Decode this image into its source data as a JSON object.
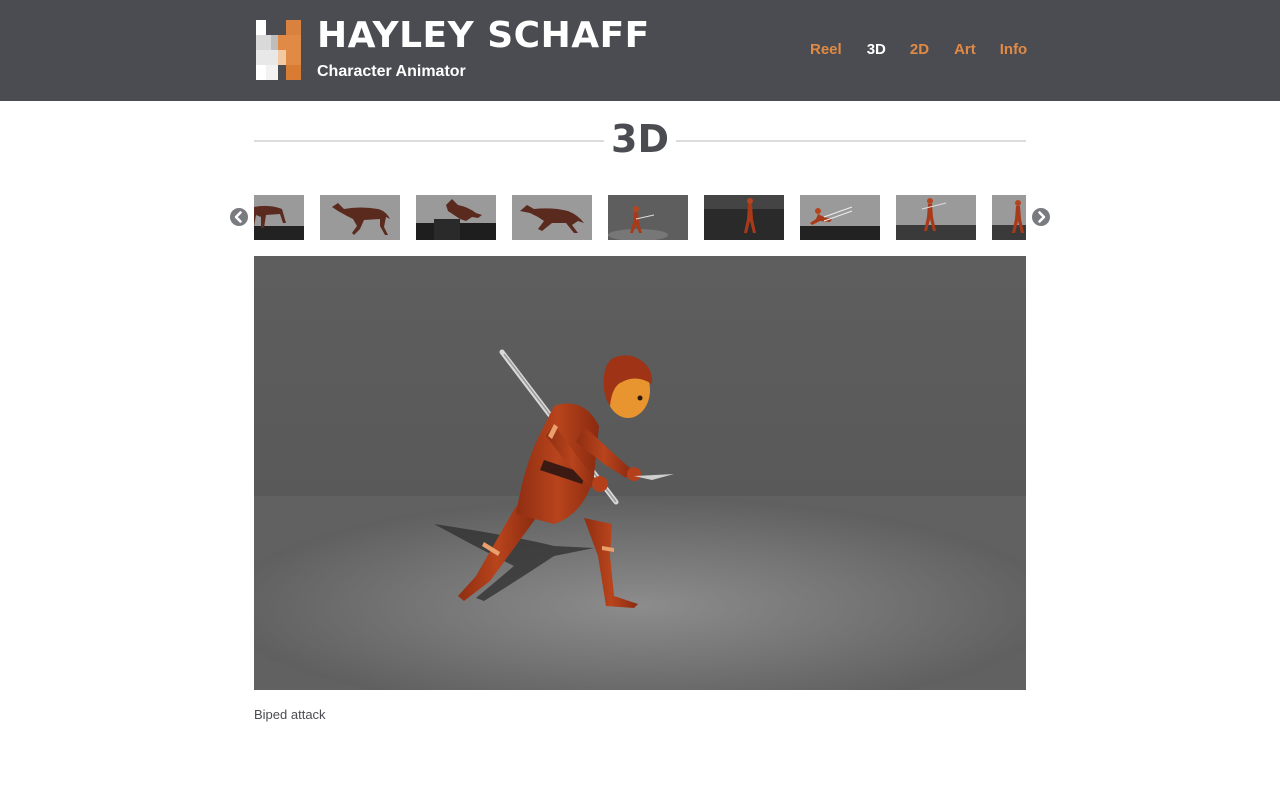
{
  "header": {
    "brand_name": "HAYLEY SCHAFF",
    "brand_subtitle": "Character Animator",
    "logo_colors": [
      "#ffffff",
      "#e6e6e6",
      "#cfcfcf",
      "#e08a45",
      "#d97c33"
    ],
    "nav": [
      {
        "label": "Reel",
        "active": false
      },
      {
        "label": "3D",
        "active": true
      },
      {
        "label": "2D",
        "active": false
      },
      {
        "label": "Art",
        "active": false
      },
      {
        "label": "Info",
        "active": false
      }
    ]
  },
  "section": {
    "title": "3D"
  },
  "gallery": {
    "prev_icon": "chevron-left-icon",
    "next_icon": "chevron-right-icon",
    "thumbnails": [
      {
        "subject": "horse",
        "bg": "light"
      },
      {
        "subject": "horse",
        "bg": "light"
      },
      {
        "subject": "horse-jump",
        "bg": "light"
      },
      {
        "subject": "horse",
        "bg": "light"
      },
      {
        "subject": "biped",
        "bg": "dark"
      },
      {
        "subject": "biped",
        "bg": "dark"
      },
      {
        "subject": "biped-lunge",
        "bg": "light"
      },
      {
        "subject": "biped",
        "bg": "light"
      },
      {
        "subject": "biped",
        "bg": "light"
      }
    ],
    "caption": "Biped attack"
  },
  "colors": {
    "header_bg": "#4b4c51",
    "accent": "#e08a45",
    "nav_active": "#ffffff",
    "title_text": "#4b4c51",
    "rule": "#dcdcdc"
  }
}
